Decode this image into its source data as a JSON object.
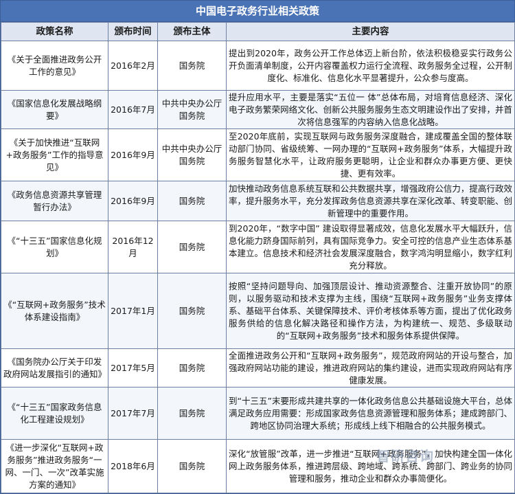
{
  "title": "中国电子政务行业相关政策",
  "headers": [
    "政策名称",
    "颁布时间",
    "颁布主体",
    "主要内容"
  ],
  "rows": [
    {
      "name": "《关于全面推进政务公开工作的意见》",
      "date": "2016年2月",
      "issuer": "国务院",
      "content": "提出到2020年，政务公开工作总体迈上新台阶，依法积极稳妥实行政务公开负面清单制度，公开内容覆盖权力运行全流程、政务服务全过程，公开制度化、标准化、信息化水平显著提升，公众参与度高。"
    },
    {
      "name": "《国家信息化发展战略纲要》",
      "date": "2016年7月",
      "issuer": "中共中央办公厅国务院",
      "content": "提升应用水平，主要是落实“五位一 体”总体布局，对培育信息经济、深化电子政务繁荣网络文化、创新公共服务服务生态文明建设作出了安排，并首次将信息强军的内容纳入信息化战略。"
    },
    {
      "name": "《关于加快推进“互联网+政务服务”工作的指导意见》",
      "date": "2016年9月",
      "issuer": "中共中央办公厅国务院",
      "content": "至2020年底前，实现互联网与政务服务深度融合，建成覆盖全国的整体联动部门协同、省级统筹、一网办理的“互联网+政务服务”体系，大幅提升政务服务智慧化水平，让政府服务更聪明，让企业和群众办事更方便、更快捷、更有效率。"
    },
    {
      "name": "《政务信息资源共享管理暂行办法》",
      "date": "2016年9月",
      "issuer": "国务院",
      "content": "加快推动政务信息系统互联和公共数据共享，增强政府公信力，提高行政效率，提升服务水平，充分发挥政务信息资源共享在深化改革、转变职能、创新管理中的重要作用。"
    },
    {
      "name": "《“十三五”国家信息化规划》",
      "date": "2016年12月",
      "issuer": "国务院",
      "content": "到2020年，“数字中国” 建设取得显著成效，信息化发展水平大幅跃升，信息化能力跻身国际前列，具有国际竞争力。安全可控的信息产业生态体系基本建立。信息技术和经济社会发展深度融合，数字鸿沟明显缩小，数字红利充分释放。"
    },
    {
      "name": "《“互联网+政务服务”技术体系建设指南》",
      "date": "2017年1月",
      "issuer": "国务院",
      "content": "按照“坚持问题导向、加强顶层设计、推动资源整合、注重开放协同”的原则，以服务驱动和技术支撑为主线，围绕“互联网+政务服务”业务支撑体系、基础平台体系、关键保障技术、评价考核体系等方面，提出了优化政务服务供给的信息化解决路径和操作方法，为构建统一、规范、多级联动的“互联网+政务服务”技术和服务体系提供保障。"
    },
    {
      "name": "《国务院办公厅关于印发政府网站发展指引的通知》",
      "date": "2017年5月",
      "issuer": "国务院",
      "content": "全面推进政务公开和“互联网+政务服务”，规范政府网站的开设与整合，加强政府网站功能的建设，推进政府网站的集约建设，进而实现政府网站有序健康发展。"
    },
    {
      "name": "《“十三五”国家政务信息化工程建设规划》",
      "date": "2017年7月",
      "issuer": "国务院",
      "content": "到“十三五”末要形成共建共享的一体化政务信息公共基础设施大平台，总体满足政务应用需要：形成国家政务信息资源管理和服务体系；建成跨部门、跨地区协同治理大系统；形成线上线下相融合的公共服务模式。"
    },
    {
      "name": "《进一步深化“互联网+政务服务”推进政务服务“一网、一门、一次”改革实施方案的通知》",
      "date": "2018年6月",
      "issuer": "国务院",
      "content": "深化“放管服”改革，进一步推进“互联网+政务服务”，加快构建全国一体化网上政务服务体系，推进跨层级、跨地域、跨系统、跨部门、跨业务的协同管理和服务，推动企业和群众办事简便化。"
    }
  ],
  "watermark": "智研咨询"
}
